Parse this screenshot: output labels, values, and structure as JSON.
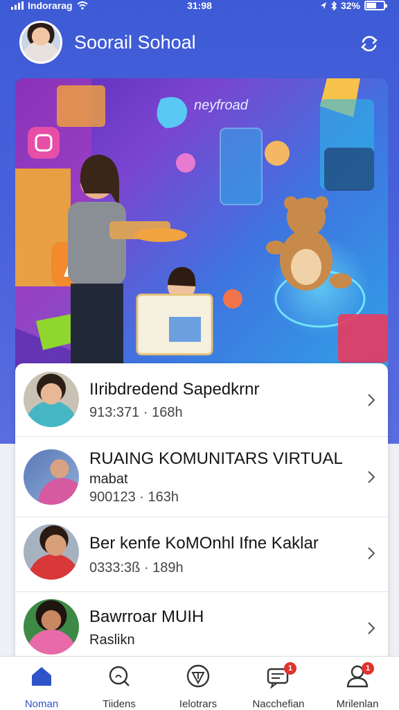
{
  "status_bar": {
    "carrier": "Indorarag",
    "time": "31:98",
    "battery": "32%"
  },
  "header": {
    "title": "Soorail Sohoal"
  },
  "hero": {
    "caption": "neyfroad"
  },
  "list": [
    {
      "title": "IIribdredend Sapedkrnr",
      "meta": "913:371 · 168h"
    },
    {
      "title": "RUAING KOMUNITARS VIRTUAL",
      "subtitle": "mabat",
      "meta": "900123 · 163h"
    },
    {
      "title": "Ber kenfe KoMOnhl Ifne Kaklar",
      "meta": "0333:3ß · 189h"
    },
    {
      "title": "Bawrroar MUIH",
      "subtitle": "Raslikn"
    }
  ],
  "nav": [
    {
      "label": "Noman",
      "icon": "home-icon",
      "active": true
    },
    {
      "label": "Tiidens",
      "icon": "search-icon"
    },
    {
      "label": "Ielotrars",
      "icon": "events-icon"
    },
    {
      "label": "Nacchefian",
      "icon": "messages-icon",
      "badge": "1"
    },
    {
      "label": "Mrilenlan",
      "icon": "profile-icon",
      "badge": "1"
    }
  ],
  "colors": {
    "header_bg": "#3d5bd6",
    "accent": "#2e54c8",
    "badge": "#e0332e"
  }
}
